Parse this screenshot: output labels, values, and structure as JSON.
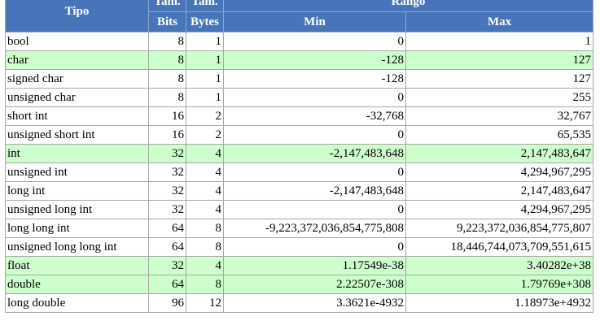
{
  "header": {
    "tipo": "Tipo",
    "tam_bits_top": "Tam.",
    "tam_bits_bottom": "Bits",
    "tam_bytes_top": "Tam.",
    "tam_bytes_bottom": "Bytes",
    "rango": "Rango",
    "min": "Min",
    "max": "Max"
  },
  "colors": {
    "header_bg": "#4875b9",
    "highlight_row": "#ccffcc",
    "border": "#a7a7a7"
  },
  "rows": [
    {
      "tipo": "bool",
      "bits": "8",
      "bytes": "1",
      "min": "0",
      "max": "1",
      "highlight": false
    },
    {
      "tipo": "char",
      "bits": "8",
      "bytes": "1",
      "min": "-128",
      "max": "127",
      "highlight": true
    },
    {
      "tipo": "signed char",
      "bits": "8",
      "bytes": "1",
      "min": "-128",
      "max": "127",
      "highlight": false
    },
    {
      "tipo": "unsigned char",
      "bits": "8",
      "bytes": "1",
      "min": "0",
      "max": "255",
      "highlight": false
    },
    {
      "tipo": "short int",
      "bits": "16",
      "bytes": "2",
      "min": "-32,768",
      "max": "32,767",
      "highlight": false
    },
    {
      "tipo": "unsigned short int",
      "bits": "16",
      "bytes": "2",
      "min": "0",
      "max": "65,535",
      "highlight": false
    },
    {
      "tipo": "int",
      "bits": "32",
      "bytes": "4",
      "min": "-2,147,483,648",
      "max": "2,147,483,647",
      "highlight": true
    },
    {
      "tipo": "unsigned int",
      "bits": "32",
      "bytes": "4",
      "min": "0",
      "max": "4,294,967,295",
      "highlight": false
    },
    {
      "tipo": "long int",
      "bits": "32",
      "bytes": "4",
      "min": "-2,147,483,648",
      "max": "2,147,483,647",
      "highlight": false
    },
    {
      "tipo": "unsigned long int",
      "bits": "32",
      "bytes": "4",
      "min": "0",
      "max": "4,294,967,295",
      "highlight": false
    },
    {
      "tipo": "long long int",
      "bits": "64",
      "bytes": "8",
      "min": "-9,223,372,036,854,775,808",
      "max": "9,223,372,036,854,775,807",
      "highlight": false
    },
    {
      "tipo": "unsigned long long int",
      "bits": "64",
      "bytes": "8",
      "min": "0",
      "max": "18,446,744,073,709,551,615",
      "highlight": false
    },
    {
      "tipo": "float",
      "bits": "32",
      "bytes": "4",
      "min": "1.17549e-38",
      "max": "3.40282e+38",
      "highlight": true
    },
    {
      "tipo": "double",
      "bits": "64",
      "bytes": "8",
      "min": "2.22507e-308",
      "max": "1.79769e+308",
      "highlight": true
    },
    {
      "tipo": "long double",
      "bits": "96",
      "bytes": "12",
      "min": "3.3621e-4932",
      "max": "1.18973e+4932",
      "highlight": false
    }
  ]
}
